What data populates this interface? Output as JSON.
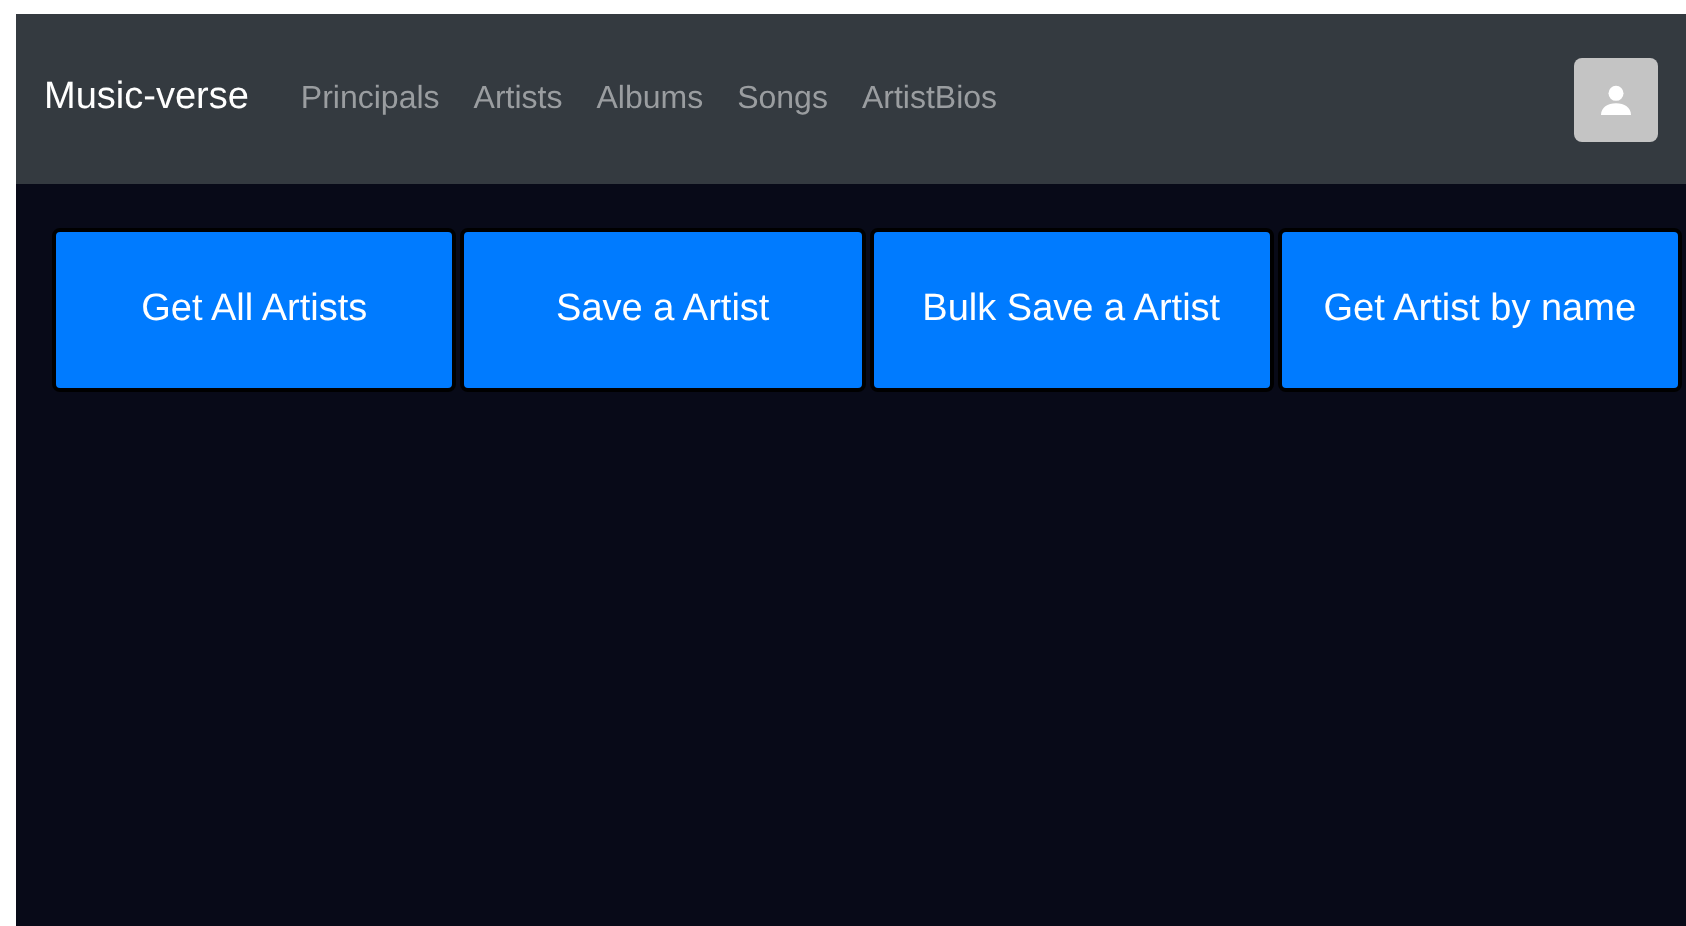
{
  "navbar": {
    "brand": "Music-verse",
    "links": [
      "Principals",
      "Artists",
      "Albums",
      "Songs",
      "ArtistBios"
    ]
  },
  "buttons": [
    "Get All Artists",
    "Save a Artist",
    "Bulk Save a Artist",
    "Get Artist by name"
  ]
}
